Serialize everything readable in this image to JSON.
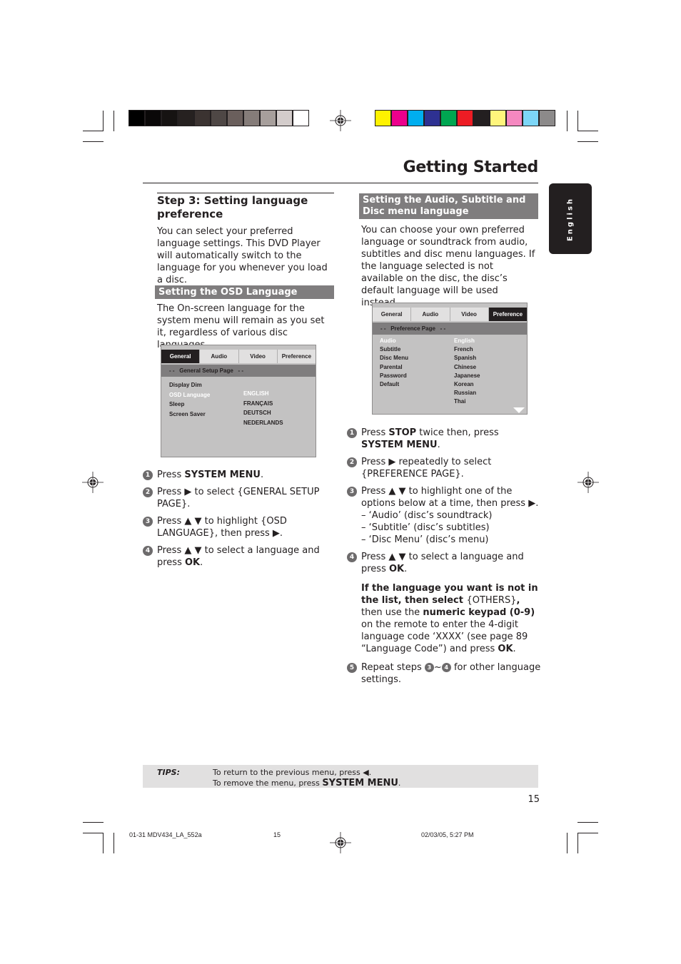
{
  "header": {
    "title": "Getting Started",
    "language_tab": "English",
    "grayscale_bars": [
      "#000000",
      "#0a0808",
      "#161312",
      "#262120",
      "#3b3331",
      "#4e4745",
      "#6a5f5c",
      "#857c79",
      "#a79f9c",
      "#d3cccb",
      "#ffffff"
    ],
    "color_bars": [
      "#fff200",
      "#ec008c",
      "#00aeef",
      "#2e3192",
      "#00a651",
      "#ed1c24",
      "#231f20",
      "#fff57c",
      "#f588c0",
      "#7dd6f7",
      "#8c8a8a"
    ]
  },
  "left": {
    "step_heading": "Step 3:  Setting language preference",
    "intro": "You can select your preferred language settings. This DVD Player will automatically switch to the language for you whenever you load a disc.",
    "section_heading": "Setting the OSD Language",
    "section_text": "The On-screen language for the system menu will remain as you set it, regardless of various disc languages.",
    "screen": {
      "tabs": [
        "General",
        "Audio",
        "Video",
        "Preference"
      ],
      "active_tab": "General",
      "page_title": "- -   General Setup Page   - -",
      "items": [
        "Display Dim",
        "OSD Language",
        "Sleep",
        "Screen Saver"
      ],
      "highlighted_item": "OSD Language",
      "options": [
        "ENGLISH",
        "FRANÇAIS",
        "DEUTSCH",
        "NEDERLANDS"
      ],
      "highlighted_option": "ENGLISH"
    },
    "steps": [
      {
        "num": "1",
        "parts": [
          [
            "Press ",
            false
          ],
          [
            "SYSTEM MENU",
            true
          ],
          [
            ".",
            false
          ]
        ]
      },
      {
        "num": "2",
        "parts": [
          [
            "Press ▶ to select {GENERAL SETUP PAGE}.",
            false
          ]
        ]
      },
      {
        "num": "3",
        "parts": [
          [
            "Press ▲ ▼ to highlight {OSD LANGUAGE}, then press ▶.",
            false
          ]
        ]
      },
      {
        "num": "4",
        "parts": [
          [
            "Press ▲ ▼  to select a language and press ",
            false
          ],
          [
            "OK",
            true
          ],
          [
            ".",
            false
          ]
        ]
      }
    ]
  },
  "right": {
    "section_heading": "Setting the Audio, Subtitle and Disc menu language",
    "intro": "You can choose your own preferred language or soundtrack from audio, subtitles and disc menu languages. If the language selected is not available on the disc, the disc’s default language will be used instead.",
    "screen": {
      "tabs": [
        "General",
        "Audio",
        "Video",
        "Preference"
      ],
      "active_tab": "Preference",
      "page_title": "- -   Preference Page   - -",
      "items": [
        "Audio",
        "Subtitle",
        "Disc Menu",
        "Parental",
        "Password",
        "Default"
      ],
      "highlighted_item": "Audio",
      "options": [
        "English",
        "French",
        "Spanish",
        "Chinese",
        "Japanese",
        "Korean",
        "Russian",
        "Thai"
      ],
      "highlighted_option": "English"
    },
    "steps": [
      {
        "num": "1",
        "parts": [
          [
            "Press ",
            false
          ],
          [
            "STOP",
            true
          ],
          [
            " twice then, press ",
            false
          ],
          [
            "SYSTEM MENU",
            true
          ],
          [
            ".",
            false
          ]
        ]
      },
      {
        "num": "2",
        "parts": [
          [
            "Press ▶ repeatedly to select {PREFERENCE PAGE}.",
            false
          ]
        ]
      },
      {
        "num": "3",
        "parts": [
          [
            "Press ▲ ▼ to highlight one of the options below at a time, then press ▶.",
            false
          ]
        ],
        "sub": [
          "–  ‘Audio’ (disc’s soundtrack)",
          "–  ‘Subtitle’ (disc’s subtitles)",
          "–  ‘Disc Menu’ (disc’s menu)"
        ]
      },
      {
        "num": "4",
        "parts": [
          [
            "Press ▲ ▼ to select a language and press ",
            false
          ],
          [
            "OK",
            true
          ],
          [
            ".",
            false
          ]
        ]
      }
    ],
    "note_parts": [
      [
        "If the language you want is not in the list, then select ",
        true
      ],
      [
        "{OTHERS}",
        false
      ],
      [
        ",",
        true
      ],
      [
        "\nthen use the ",
        false
      ],
      [
        "numeric keypad (0-9)",
        true
      ],
      [
        " on the remote to enter the 4-digit language code ‘XXXX’ (see page 89 “Language Code”) and press ",
        false
      ],
      [
        "OK",
        true
      ],
      [
        ".",
        false
      ]
    ],
    "step5": {
      "num": "5",
      "before": "Repeat steps ",
      "ref_a": "3",
      "sep": "~",
      "ref_b": "4",
      "after": " for other language settings."
    }
  },
  "tips": {
    "label": "TIPS:",
    "line1": "To return to the previous menu, press ◀.",
    "line2_prefix": "To remove the menu, press ",
    "line2_bold": "SYSTEM MENU",
    "line2_suffix": "."
  },
  "page_number": "15",
  "footer": {
    "file": "01-31 MDV434_LA_552a",
    "page": "15",
    "timestamp": "02/03/05, 5:27 PM"
  }
}
